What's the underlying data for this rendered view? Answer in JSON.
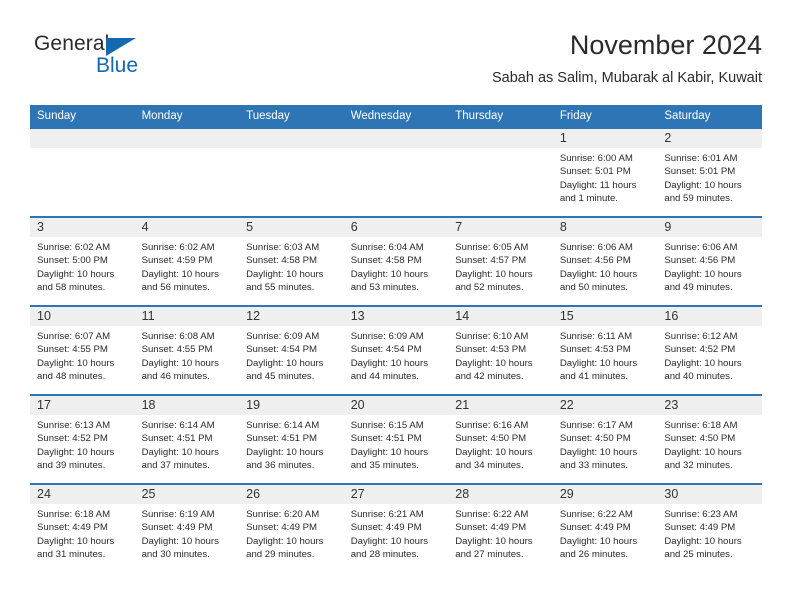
{
  "brand": {
    "name_top": "General",
    "name_bottom": "Blue",
    "triangle_color": "#1569b0"
  },
  "header": {
    "title": "November 2024",
    "subtitle": "Sabah as Salim, Mubarak al Kabir, Kuwait"
  },
  "theme": {
    "header_blue": "#2e75b6",
    "daynum_gray": "#efefef",
    "text": "#2b2b2b"
  },
  "weekday_headers": [
    "Sunday",
    "Monday",
    "Tuesday",
    "Wednesday",
    "Thursday",
    "Friday",
    "Saturday"
  ],
  "weeks": [
    [
      {
        "day": "",
        "sunrise": "",
        "sunset": "",
        "daylight": ""
      },
      {
        "day": "",
        "sunrise": "",
        "sunset": "",
        "daylight": ""
      },
      {
        "day": "",
        "sunrise": "",
        "sunset": "",
        "daylight": ""
      },
      {
        "day": "",
        "sunrise": "",
        "sunset": "",
        "daylight": ""
      },
      {
        "day": "",
        "sunrise": "",
        "sunset": "",
        "daylight": ""
      },
      {
        "day": "1",
        "sunrise": "Sunrise: 6:00 AM",
        "sunset": "Sunset: 5:01 PM",
        "daylight": "Daylight: 11 hours and 1 minute."
      },
      {
        "day": "2",
        "sunrise": "Sunrise: 6:01 AM",
        "sunset": "Sunset: 5:01 PM",
        "daylight": "Daylight: 10 hours and 59 minutes."
      }
    ],
    [
      {
        "day": "3",
        "sunrise": "Sunrise: 6:02 AM",
        "sunset": "Sunset: 5:00 PM",
        "daylight": "Daylight: 10 hours and 58 minutes."
      },
      {
        "day": "4",
        "sunrise": "Sunrise: 6:02 AM",
        "sunset": "Sunset: 4:59 PM",
        "daylight": "Daylight: 10 hours and 56 minutes."
      },
      {
        "day": "5",
        "sunrise": "Sunrise: 6:03 AM",
        "sunset": "Sunset: 4:58 PM",
        "daylight": "Daylight: 10 hours and 55 minutes."
      },
      {
        "day": "6",
        "sunrise": "Sunrise: 6:04 AM",
        "sunset": "Sunset: 4:58 PM",
        "daylight": "Daylight: 10 hours and 53 minutes."
      },
      {
        "day": "7",
        "sunrise": "Sunrise: 6:05 AM",
        "sunset": "Sunset: 4:57 PM",
        "daylight": "Daylight: 10 hours and 52 minutes."
      },
      {
        "day": "8",
        "sunrise": "Sunrise: 6:06 AM",
        "sunset": "Sunset: 4:56 PM",
        "daylight": "Daylight: 10 hours and 50 minutes."
      },
      {
        "day": "9",
        "sunrise": "Sunrise: 6:06 AM",
        "sunset": "Sunset: 4:56 PM",
        "daylight": "Daylight: 10 hours and 49 minutes."
      }
    ],
    [
      {
        "day": "10",
        "sunrise": "Sunrise: 6:07 AM",
        "sunset": "Sunset: 4:55 PM",
        "daylight": "Daylight: 10 hours and 48 minutes."
      },
      {
        "day": "11",
        "sunrise": "Sunrise: 6:08 AM",
        "sunset": "Sunset: 4:55 PM",
        "daylight": "Daylight: 10 hours and 46 minutes."
      },
      {
        "day": "12",
        "sunrise": "Sunrise: 6:09 AM",
        "sunset": "Sunset: 4:54 PM",
        "daylight": "Daylight: 10 hours and 45 minutes."
      },
      {
        "day": "13",
        "sunrise": "Sunrise: 6:09 AM",
        "sunset": "Sunset: 4:54 PM",
        "daylight": "Daylight: 10 hours and 44 minutes."
      },
      {
        "day": "14",
        "sunrise": "Sunrise: 6:10 AM",
        "sunset": "Sunset: 4:53 PM",
        "daylight": "Daylight: 10 hours and 42 minutes."
      },
      {
        "day": "15",
        "sunrise": "Sunrise: 6:11 AM",
        "sunset": "Sunset: 4:53 PM",
        "daylight": "Daylight: 10 hours and 41 minutes."
      },
      {
        "day": "16",
        "sunrise": "Sunrise: 6:12 AM",
        "sunset": "Sunset: 4:52 PM",
        "daylight": "Daylight: 10 hours and 40 minutes."
      }
    ],
    [
      {
        "day": "17",
        "sunrise": "Sunrise: 6:13 AM",
        "sunset": "Sunset: 4:52 PM",
        "daylight": "Daylight: 10 hours and 39 minutes."
      },
      {
        "day": "18",
        "sunrise": "Sunrise: 6:14 AM",
        "sunset": "Sunset: 4:51 PM",
        "daylight": "Daylight: 10 hours and 37 minutes."
      },
      {
        "day": "19",
        "sunrise": "Sunrise: 6:14 AM",
        "sunset": "Sunset: 4:51 PM",
        "daylight": "Daylight: 10 hours and 36 minutes."
      },
      {
        "day": "20",
        "sunrise": "Sunrise: 6:15 AM",
        "sunset": "Sunset: 4:51 PM",
        "daylight": "Daylight: 10 hours and 35 minutes."
      },
      {
        "day": "21",
        "sunrise": "Sunrise: 6:16 AM",
        "sunset": "Sunset: 4:50 PM",
        "daylight": "Daylight: 10 hours and 34 minutes."
      },
      {
        "day": "22",
        "sunrise": "Sunrise: 6:17 AM",
        "sunset": "Sunset: 4:50 PM",
        "daylight": "Daylight: 10 hours and 33 minutes."
      },
      {
        "day": "23",
        "sunrise": "Sunrise: 6:18 AM",
        "sunset": "Sunset: 4:50 PM",
        "daylight": "Daylight: 10 hours and 32 minutes."
      }
    ],
    [
      {
        "day": "24",
        "sunrise": "Sunrise: 6:18 AM",
        "sunset": "Sunset: 4:49 PM",
        "daylight": "Daylight: 10 hours and 31 minutes."
      },
      {
        "day": "25",
        "sunrise": "Sunrise: 6:19 AM",
        "sunset": "Sunset: 4:49 PM",
        "daylight": "Daylight: 10 hours and 30 minutes."
      },
      {
        "day": "26",
        "sunrise": "Sunrise: 6:20 AM",
        "sunset": "Sunset: 4:49 PM",
        "daylight": "Daylight: 10 hours and 29 minutes."
      },
      {
        "day": "27",
        "sunrise": "Sunrise: 6:21 AM",
        "sunset": "Sunset: 4:49 PM",
        "daylight": "Daylight: 10 hours and 28 minutes."
      },
      {
        "day": "28",
        "sunrise": "Sunrise: 6:22 AM",
        "sunset": "Sunset: 4:49 PM",
        "daylight": "Daylight: 10 hours and 27 minutes."
      },
      {
        "day": "29",
        "sunrise": "Sunrise: 6:22 AM",
        "sunset": "Sunset: 4:49 PM",
        "daylight": "Daylight: 10 hours and 26 minutes."
      },
      {
        "day": "30",
        "sunrise": "Sunrise: 6:23 AM",
        "sunset": "Sunset: 4:49 PM",
        "daylight": "Daylight: 10 hours and 25 minutes."
      }
    ]
  ]
}
